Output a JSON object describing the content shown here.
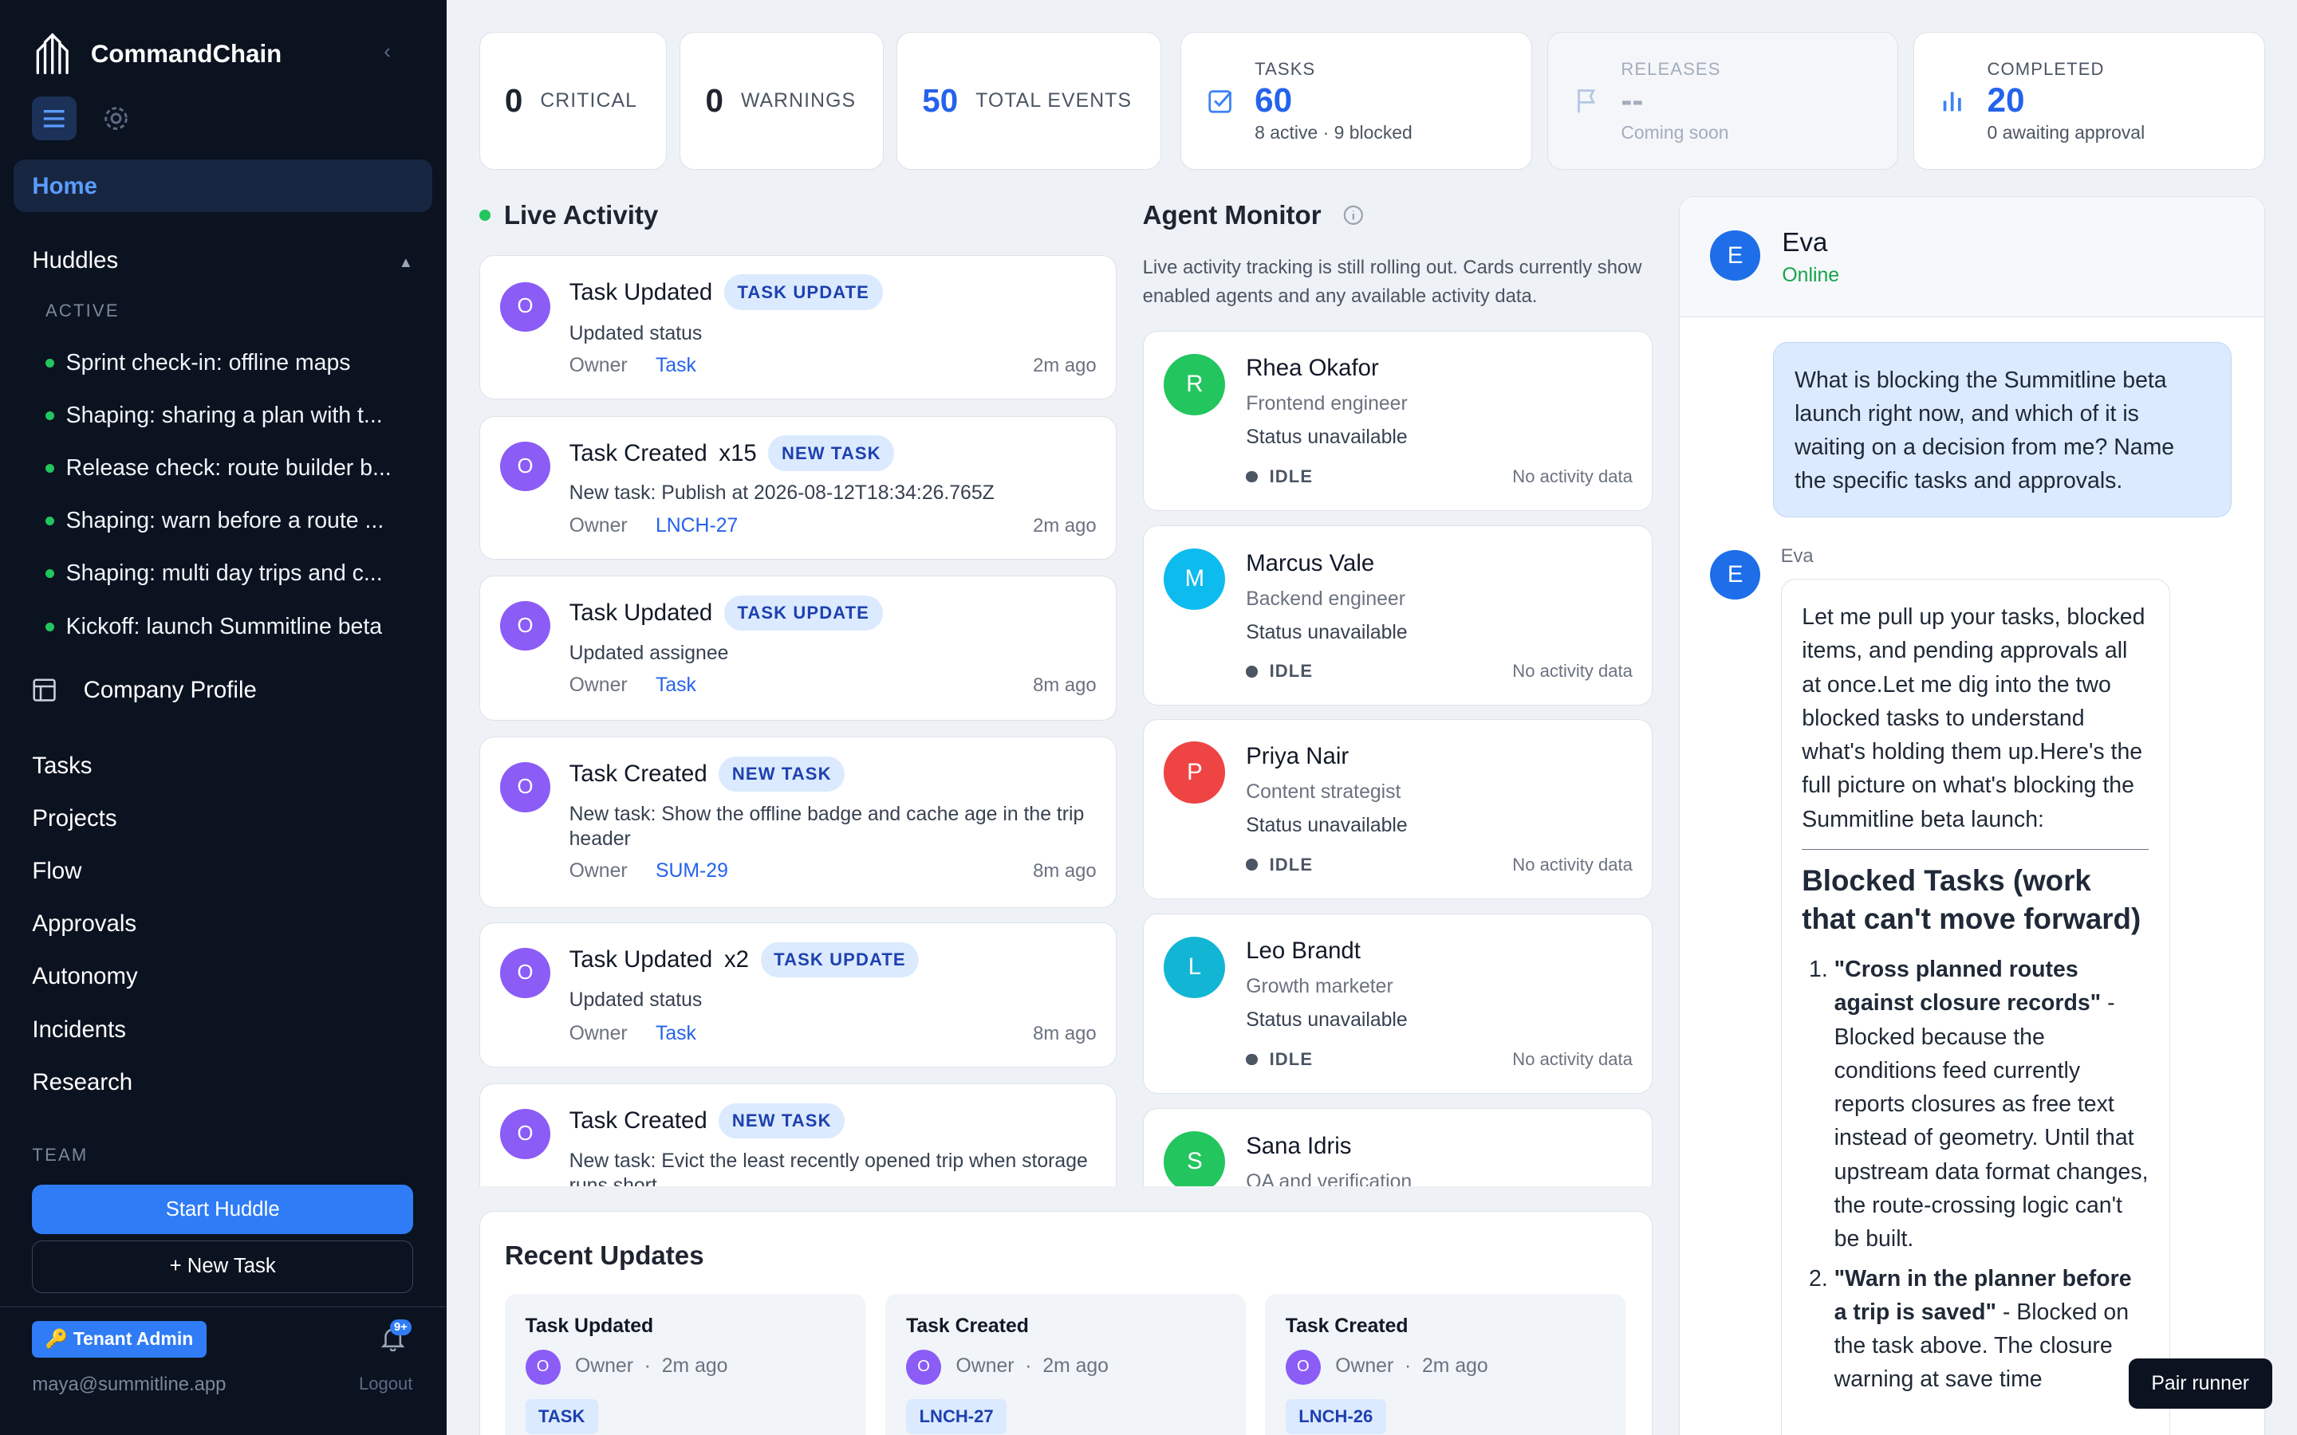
{
  "app": {
    "name": "CommandChain"
  },
  "sidebar": {
    "home": "Home",
    "huddles_title": "Huddles",
    "active_label": "ACTIVE",
    "huddles": [
      "Sprint check-in: offline maps",
      "Shaping: sharing a plan with t...",
      "Release check: route builder b...",
      "Shaping: warn before a route ...",
      "Shaping: multi day trips and c...",
      "Kickoff: launch Summitline beta"
    ],
    "company_profile": "Company Profile",
    "nav": [
      "Tasks",
      "Projects",
      "Flow",
      "Approvals",
      "Autonomy",
      "Incidents",
      "Research"
    ],
    "team_label": "TEAM",
    "start_huddle": "Start Huddle",
    "new_task": "+ New Task",
    "tenant_admin": "🔑 Tenant Admin",
    "notif_count": "9+",
    "email": "maya@summitline.app",
    "logout": "Logout"
  },
  "stats": {
    "critical": {
      "value": "0",
      "label": "CRITICAL"
    },
    "warnings": {
      "value": "0",
      "label": "WARNINGS"
    },
    "total_events": {
      "value": "50",
      "label": "TOTAL EVENTS"
    },
    "tasks": {
      "title": "TASKS",
      "value": "60",
      "sub": "8 active · 9 blocked"
    },
    "releases": {
      "title": "RELEASES",
      "value": "--",
      "sub": "Coming soon"
    },
    "completed": {
      "title": "COMPLETED",
      "value": "20",
      "sub": "0 awaiting approval"
    }
  },
  "live_activity": {
    "title": "Live Activity",
    "events": [
      {
        "avatar": "O",
        "title": "Task Updated",
        "mult": "",
        "badge": "TASK UPDATE",
        "sub": "Updated status",
        "owner": "Owner",
        "link": "Task",
        "time": "2m ago"
      },
      {
        "avatar": "O",
        "title": "Task Created",
        "mult": "x15",
        "badge": "NEW TASK",
        "sub": "New task: Publish at 2026-08-12T18:34:26.765Z",
        "owner": "Owner",
        "link": "LNCH-27",
        "time": "2m ago"
      },
      {
        "avatar": "O",
        "title": "Task Updated",
        "mult": "",
        "badge": "TASK UPDATE",
        "sub": "Updated assignee",
        "owner": "Owner",
        "link": "Task",
        "time": "8m ago"
      },
      {
        "avatar": "O",
        "title": "Task Created",
        "mult": "",
        "badge": "NEW TASK",
        "sub": "New task: Show the offline badge and cache age in the trip header",
        "owner": "Owner",
        "link": "SUM-29",
        "time": "8m ago"
      },
      {
        "avatar": "O",
        "title": "Task Updated",
        "mult": "x2",
        "badge": "TASK UPDATE",
        "sub": "Updated status",
        "owner": "Owner",
        "link": "Task",
        "time": "8m ago"
      },
      {
        "avatar": "O",
        "title": "Task Created",
        "mult": "",
        "badge": "NEW TASK",
        "sub": "New task: Evict the least recently opened trip when storage runs short",
        "owner": "",
        "link": "",
        "time": ""
      }
    ]
  },
  "agent_monitor": {
    "title": "Agent Monitor",
    "info": "Live activity tracking is still rolling out. Cards currently show enabled agents and any available activity data.",
    "agents": [
      {
        "initial": "R",
        "name": "Rhea Okafor",
        "role": "Frontend engineer",
        "status": "Status unavailable",
        "state": "IDLE",
        "activity": "No activity data",
        "color": "#22c55e"
      },
      {
        "initial": "M",
        "name": "Marcus Vale",
        "role": "Backend engineer",
        "status": "Status unavailable",
        "state": "IDLE",
        "activity": "No activity data",
        "color": "#0ebbee"
      },
      {
        "initial": "P",
        "name": "Priya Nair",
        "role": "Content strategist",
        "status": "Status unavailable",
        "state": "IDLE",
        "activity": "No activity data",
        "color": "#ef4444"
      },
      {
        "initial": "L",
        "name": "Leo Brandt",
        "role": "Growth marketer",
        "status": "Status unavailable",
        "state": "IDLE",
        "activity": "No activity data",
        "color": "#13b5d4"
      },
      {
        "initial": "S",
        "name": "Sana Idris",
        "role": "QA and verification",
        "status": "",
        "state": "",
        "activity": "",
        "color": "#22c55e"
      }
    ]
  },
  "recent_updates": {
    "title": "Recent Updates",
    "items": [
      {
        "title": "Task Updated",
        "avatar": "O",
        "owner": "Owner",
        "time": "2m ago",
        "badge": "TASK"
      },
      {
        "title": "Task Created",
        "avatar": "O",
        "owner": "Owner",
        "time": "2m ago",
        "badge": "LNCH-27"
      },
      {
        "title": "Task Created",
        "avatar": "O",
        "owner": "Owner",
        "time": "2m ago",
        "badge": "LNCH-26"
      }
    ]
  },
  "chat": {
    "agent_initial": "E",
    "agent_name": "Eva",
    "agent_status": "Online",
    "user_message": "What is blocking the Summitline beta launch right now, and which of it is waiting on a decision from me? Name the specific tasks and approvals.",
    "bot_label": "Eva",
    "bot_intro": "Let me pull up your tasks, blocked items, and pending approvals all at once.Let me dig into the two blocked tasks to understand what's holding them up.Here's the full picture on what's blocking the Summitline beta launch:",
    "bot_heading": "Blocked Tasks (work that can't move forward)",
    "bot_items": [
      {
        "bold": "\"Cross planned routes against closure records\"",
        "text": " - Blocked because the conditions feed currently reports closures as free text instead of geometry. Until that upstream data format changes, the route-crossing logic can't be built."
      },
      {
        "bold": "\"Warn in the planner before a trip is saved\"",
        "text": " - Blocked on the task above. The closure warning at save time"
      }
    ]
  },
  "pair_runner": "Pair runner"
}
